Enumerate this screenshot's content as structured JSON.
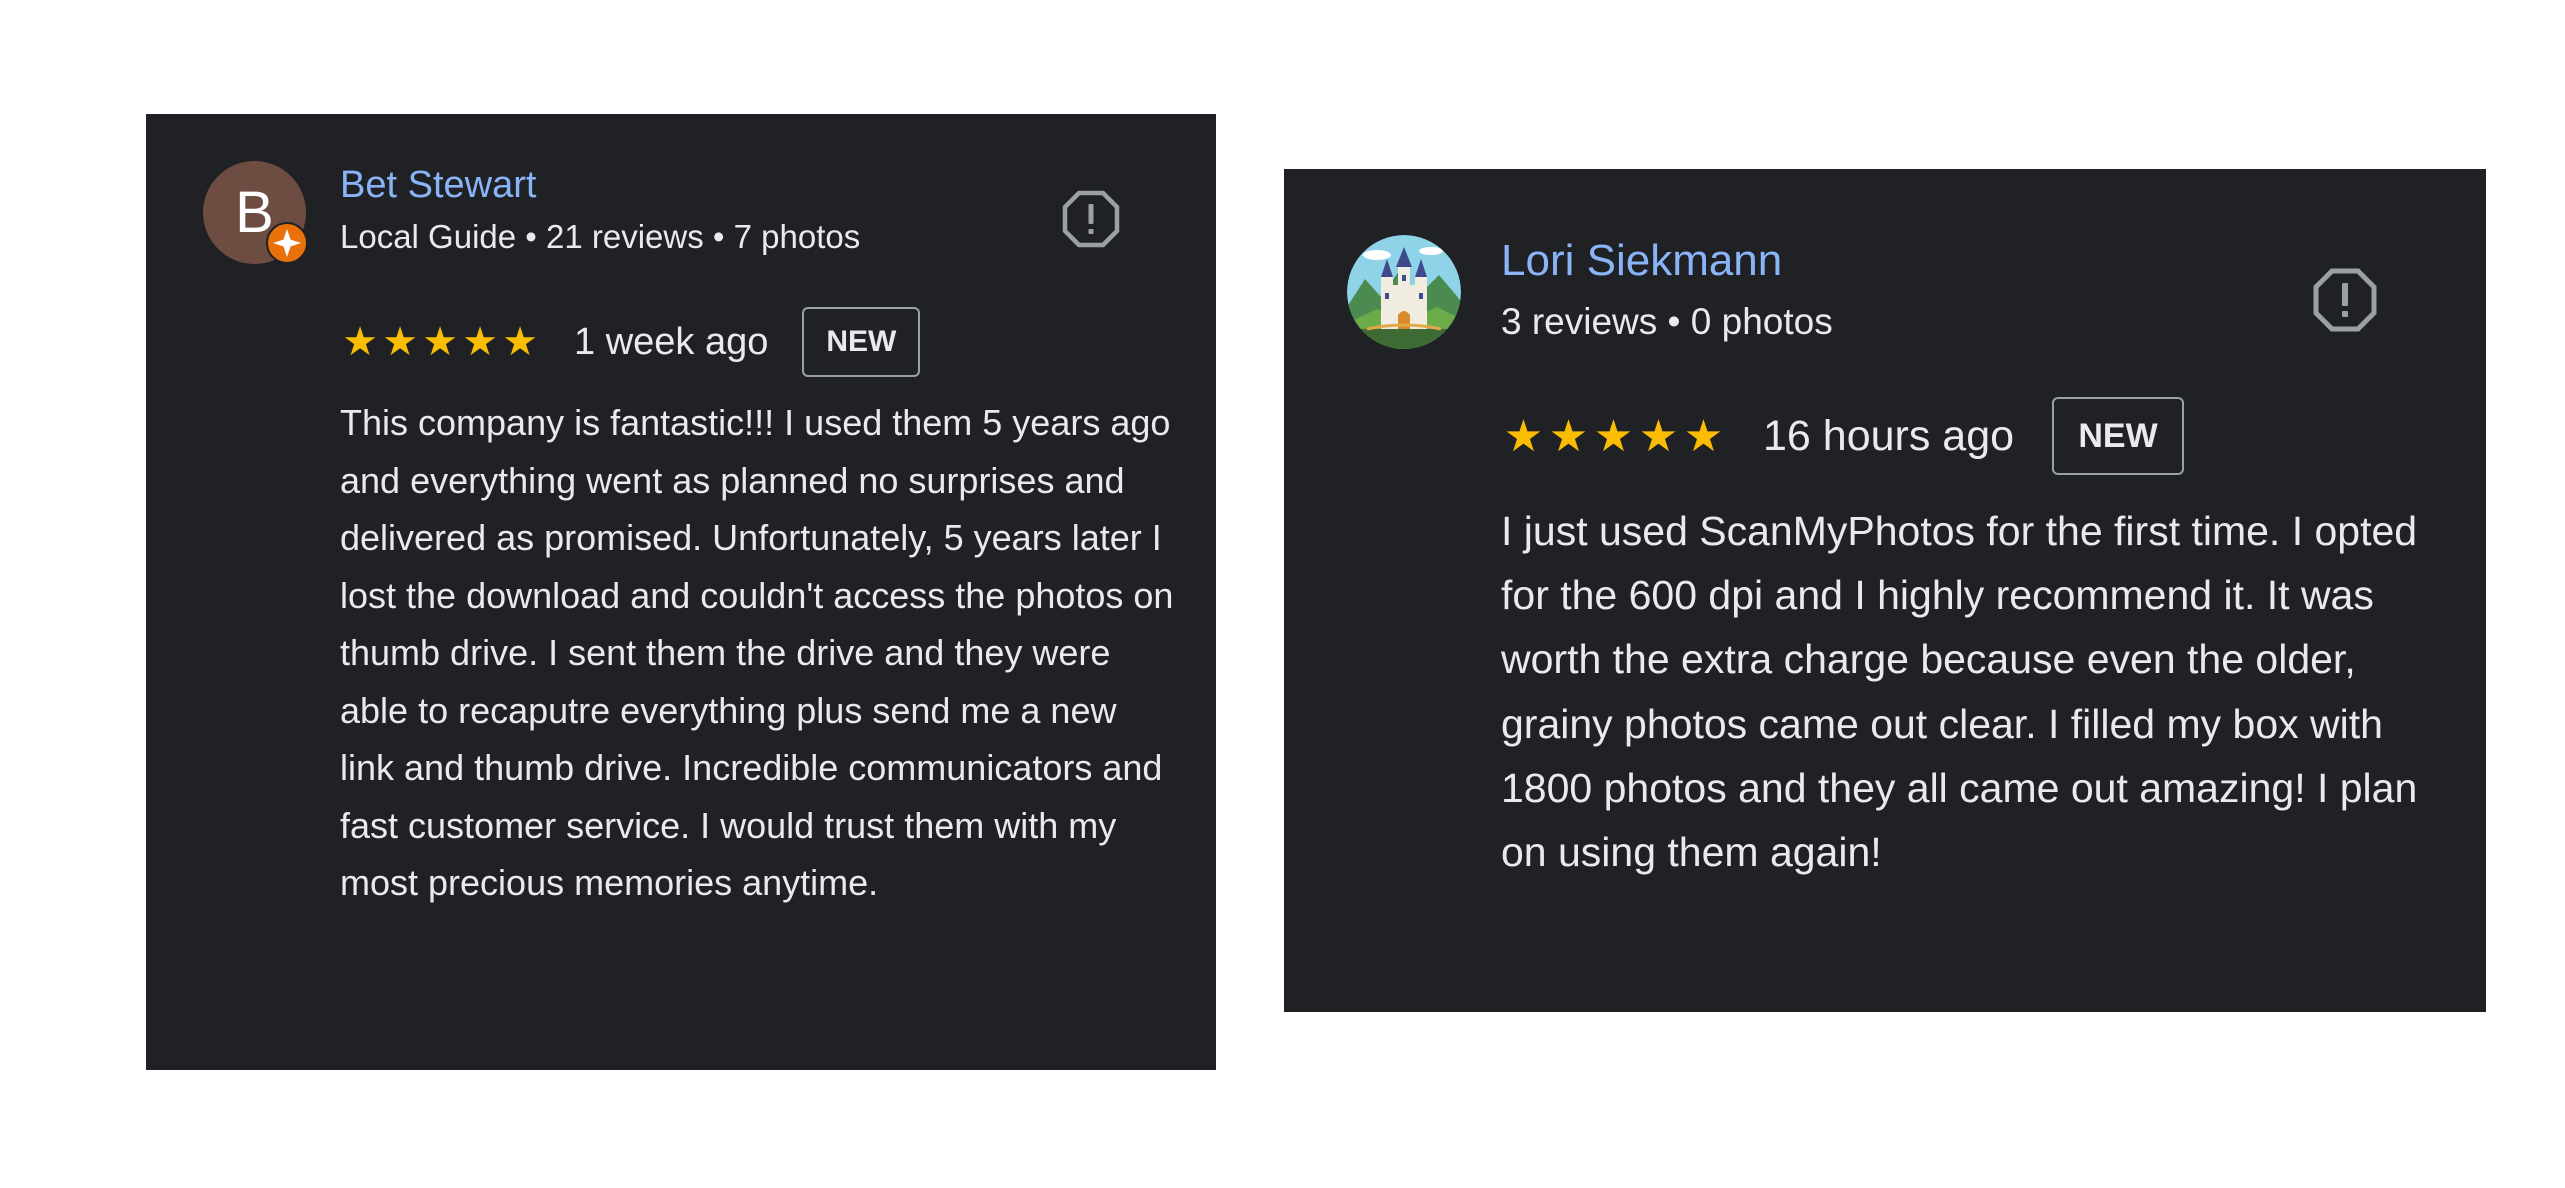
{
  "reviews": [
    {
      "name": "Bet Stewart",
      "avatar_letter": "B",
      "meta": "Local Guide • 21 reviews • 7 photos",
      "stars": [
        "★",
        "★",
        "★",
        "★",
        "★"
      ],
      "rating": 5,
      "time": "1 week ago",
      "badge": "NEW",
      "text": "This company is fantastic!!! I used them 5 years ago and everything went as planned no surprises and delivered as promised. Unfortunately, 5 years later I lost the download and couldn't access the photos on thumb drive. I sent them the drive and they were able to recaputre everything plus send me a new link and thumb drive. Incredible communicators and fast customer service. I would trust them with my most precious memories anytime."
    },
    {
      "name": "Lori Siekmann",
      "meta": "3 reviews • 0 photos",
      "stars": [
        "★",
        "★",
        "★",
        "★",
        "★"
      ],
      "rating": 5,
      "time": "16 hours ago",
      "badge": "NEW",
      "text": "I just used ScanMyPhotos for the first time. I opted for the 600 dpi and I highly recommend it. It was worth the extra charge because even the older, grainy photos came out clear. I filled my box with 1800 photos and they all came out amazing! I plan on using them again!"
    }
  ],
  "colors": {
    "card_background": "#202124",
    "name": "#8ab4f8",
    "star": "#fbbc04",
    "text": "#e8eaed",
    "avatar_1": "#6d4c41",
    "guide_badge": "#e8710a"
  },
  "icons": {
    "flag": "report-flag-icon",
    "guide": "local-guide-badge-icon",
    "star": "star-icon"
  }
}
